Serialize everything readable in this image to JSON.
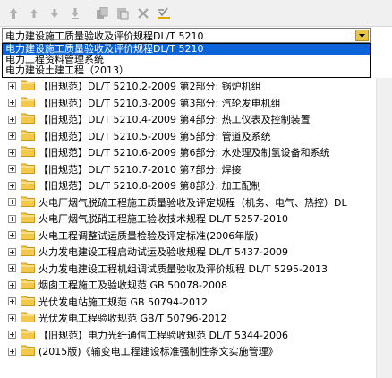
{
  "toolbar": {
    "buttons": [
      {
        "name": "arrow-up-icon",
        "glyph": "🡅"
      },
      {
        "name": "arrow-up-small-icon",
        "glyph": "↑"
      },
      {
        "name": "arrow-down-icon",
        "glyph": "↓"
      },
      {
        "name": "arrow-down-end-icon",
        "glyph": "⤓"
      },
      {
        "name": "copy-icon",
        "glyph": "▮"
      },
      {
        "name": "paste-icon",
        "glyph": "▯"
      },
      {
        "name": "delete-icon",
        "glyph": "✕"
      },
      {
        "name": "check-filter-icon",
        "glyph": "✓"
      }
    ]
  },
  "combo": {
    "value": "电力建设施工质量验收及评价规程DL/T 5210",
    "options": [
      "电力建设施工质量验收及评价规程DL/T 5210",
      "电力工程资料管理系统",
      "电力建设土建工程（2013）"
    ],
    "selected_index": 0
  },
  "tree": {
    "folder_color": "#f2c94c",
    "items": [
      {
        "prefix": "【旧规范】",
        "text": "DL/T 5210.2-2009 第2部分: 锅炉机组"
      },
      {
        "prefix": "【旧规范】",
        "text": "DL/T 5210.3-2009 第3部分: 汽轮发电机组"
      },
      {
        "prefix": "【旧规范】",
        "text": "DL/T 5210.4-2009 第4部分: 热工仪表及控制装置"
      },
      {
        "prefix": "【旧规范】",
        "text": "DL/T 5210.5-2009 第5部分: 管道及系统"
      },
      {
        "prefix": "【旧规范】",
        "text": "DL/T 5210.6-2009 第6部分: 水处理及制氢设备和系统"
      },
      {
        "prefix": "【旧规范】",
        "text": "DL/T 5210.7-2010 第7部分: 焊接"
      },
      {
        "prefix": "【旧规范】",
        "text": "DL/T 5210.8-2009 第8部分: 加工配制"
      },
      {
        "prefix": "",
        "text": "火电厂烟气脱硫工程施工质量验收及评定规程（机务、电气、热控）DL"
      },
      {
        "prefix": "",
        "text": "火电厂烟气脱硝工程施工验收技术规程 DL/T 5257-2010"
      },
      {
        "prefix": "",
        "text": "火电工程调整试运质量检验及评定标准(2006年版)"
      },
      {
        "prefix": "",
        "text": "火力发电建设工程启动试运及验收规程 DL/T 5437-2009"
      },
      {
        "prefix": "",
        "text": "火力发电建设工程机组调试质量验收及评价规程 DL/T 5295-2013"
      },
      {
        "prefix": "",
        "text": "烟囱工程施工及验收规范 GB 50078-2008"
      },
      {
        "prefix": "",
        "text": "光伏发电站施工规范 GB 50794-2012"
      },
      {
        "prefix": "",
        "text": "光伏发电工程验收规范 GB/T 50796-2012"
      },
      {
        "prefix": "【旧规范】",
        "text": "电力光纤通信工程验收规范 DL/T 5344-2006"
      },
      {
        "prefix": "",
        "text": "(2015版)《输变电工程建设标准强制性条文实施管理》"
      }
    ]
  }
}
